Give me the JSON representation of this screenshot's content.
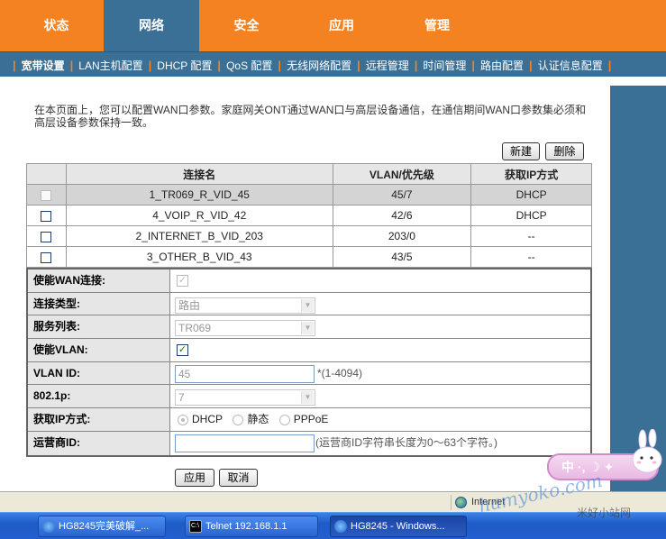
{
  "top_tabs": [
    {
      "label": "状态",
      "active": false
    },
    {
      "label": "网络",
      "active": true
    },
    {
      "label": "安全",
      "active": false
    },
    {
      "label": "应用",
      "active": false
    },
    {
      "label": "管理",
      "active": false
    }
  ],
  "sub_tabs": [
    {
      "label": "宽带设置",
      "active": true
    },
    {
      "label": "LAN主机配置"
    },
    {
      "label": "DHCP 配置"
    },
    {
      "label": "QoS 配置"
    },
    {
      "label": "无线网络配置"
    },
    {
      "label": "远程管理"
    },
    {
      "label": "时间管理"
    },
    {
      "label": "路由配置"
    },
    {
      "label": "认证信息配置"
    }
  ],
  "description": "在本页面上，您可以配置WAN口参数。家庭网关ONT通过WAN口与高层设备通信，在通信期间WAN口参数集必须和高层设备参数保持一致。",
  "buttons": {
    "new": "新建",
    "delete": "删除",
    "apply": "应用",
    "cancel": "取消"
  },
  "wan_table": {
    "headers": [
      "连接名",
      "VLAN/优先级",
      "获取IP方式"
    ],
    "rows": [
      {
        "name": "1_TR069_R_VID_45",
        "vlan": "45/7",
        "ip": "DHCP",
        "selected": true
      },
      {
        "name": "4_VOIP_R_VID_42",
        "vlan": "42/6",
        "ip": "DHCP"
      },
      {
        "name": "2_INTERNET_B_VID_203",
        "vlan": "203/0",
        "ip": "--"
      },
      {
        "name": "3_OTHER_B_VID_43",
        "vlan": "43/5",
        "ip": "--"
      }
    ]
  },
  "form": {
    "enable_wan": {
      "label": "使能WAN连接:",
      "checked": true
    },
    "conn_type": {
      "label": "连接类型:",
      "value": "路由"
    },
    "service_list": {
      "label": "服务列表:",
      "value": "TR069"
    },
    "enable_vlan": {
      "label": "使能VLAN:",
      "checked": true
    },
    "vlan_id": {
      "label": "VLAN ID:",
      "value": "45",
      "hint": "*(1-4094)"
    },
    "dot1p": {
      "label": "802.1p:",
      "value": "7"
    },
    "ip_mode": {
      "label": "获取IP方式:",
      "options": [
        "DHCP",
        "静态",
        "PPPoE"
      ],
      "selected": "DHCP"
    },
    "isp_id": {
      "label": "运营商ID:",
      "value": "",
      "hint": "(运营商ID字符串长度为0～63个字符。)"
    }
  },
  "statusbar": {
    "zone": "Internet"
  },
  "taskbar": {
    "tasks": [
      {
        "label": "HG8245完美破解_...",
        "icon": "ie-icon"
      },
      {
        "label": "Telnet 192.168.1.1",
        "icon": "cmd-icon"
      },
      {
        "label": "HG8245 - Windows...",
        "icon": "ie-icon",
        "active": true
      }
    ]
  },
  "ime": {
    "label": "中"
  },
  "overlay": {
    "watermark": "hamyoko.com",
    "tray_text": "米好小站网"
  }
}
